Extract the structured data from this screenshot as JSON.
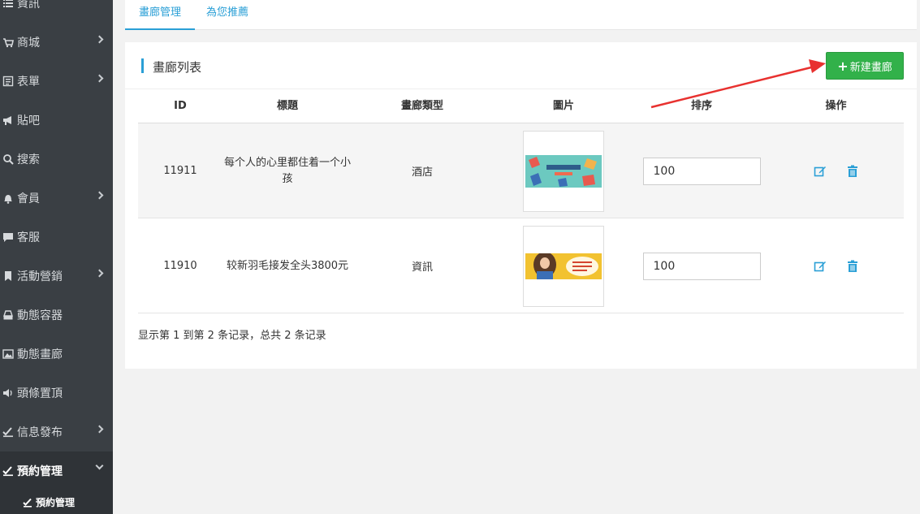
{
  "sidebar": {
    "items": [
      {
        "label": "資訊",
        "icon": "list-icon",
        "has_children": false
      },
      {
        "label": "商城",
        "icon": "cart-icon",
        "has_children": true
      },
      {
        "label": "表單",
        "icon": "form-icon",
        "has_children": true
      },
      {
        "label": "貼吧",
        "icon": "bullhorn-icon",
        "has_children": false
      },
      {
        "label": "搜索",
        "icon": "search-icon",
        "has_children": false
      },
      {
        "label": "會員",
        "icon": "bell-icon",
        "has_children": true
      },
      {
        "label": "客服",
        "icon": "comment-icon",
        "has_children": false
      },
      {
        "label": "活動營銷",
        "icon": "bookmark-icon",
        "has_children": true
      },
      {
        "label": "動態容器",
        "icon": "hdd-icon",
        "has_children": false
      },
      {
        "label": "動態畫廊",
        "icon": "picture-icon",
        "has_children": false
      },
      {
        "label": "頭條置頂",
        "icon": "volume-icon",
        "has_children": false
      },
      {
        "label": "信息發布",
        "icon": "check-icon",
        "has_children": true
      },
      {
        "label": "預約管理",
        "icon": "check-icon",
        "has_children": true
      }
    ],
    "sub_item": {
      "label": "預約管理",
      "icon": "check-icon"
    }
  },
  "tabs": [
    {
      "label": "畫廊管理"
    },
    {
      "label": "為您推薦"
    }
  ],
  "panel": {
    "title": "畫廊列表",
    "add_button": "新建畫廊"
  },
  "table": {
    "headers": [
      "ID",
      "標題",
      "畫廊類型",
      "圖片",
      "排序",
      "操作"
    ],
    "rows": [
      {
        "id": "11911",
        "title": "每个人的心里都住着一个小孩",
        "type": "酒店",
        "sort": "100",
        "thumb": "teal-banner-image"
      },
      {
        "id": "11910",
        "title": "较新羽毛接发全头3800元",
        "type": "資訊",
        "sort": "100",
        "thumb": "girl-banner-image"
      }
    ]
  },
  "footer": "显示第 1 到第 2 条记录，总共 2 条记录",
  "colors": {
    "sidebar_bg": "#3a3f44",
    "accent": "#2a9fd6",
    "add_button": "#32b14a",
    "annotation_arrow": "#e8312f"
  }
}
